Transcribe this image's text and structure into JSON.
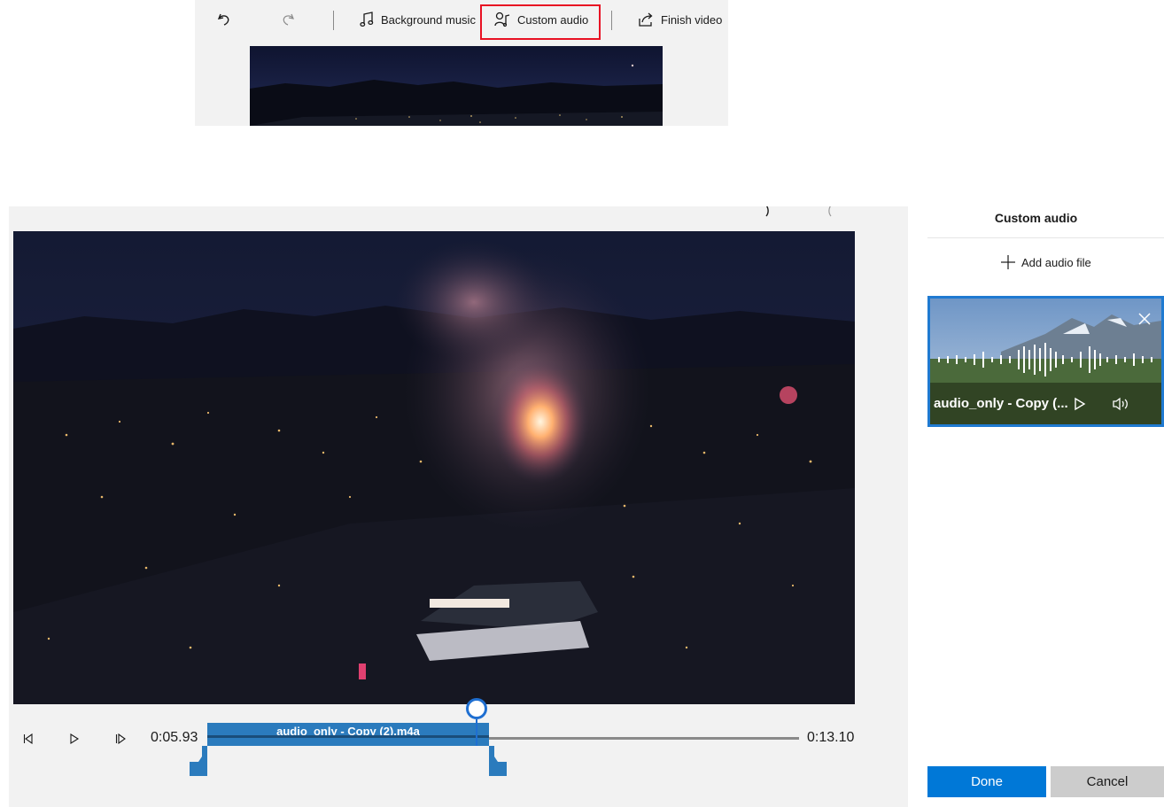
{
  "toolbar": {
    "undo_icon": "undo-icon",
    "redo_icon": "redo-icon",
    "background_music_label": "Background music",
    "custom_audio_label": "Custom audio",
    "finish_video_label": "Finish video",
    "highlight_color": "#e81123"
  },
  "playback": {
    "current_time": "0:05.93",
    "end_time": "0:13.10",
    "progress": 0.45
  },
  "timeline": {
    "clip_label": "audio_only - Copy (2).m4a",
    "clip_color": "#2b7bbd"
  },
  "panel": {
    "title": "Custom audio",
    "add_audio_label": "Add audio file",
    "audio_card": {
      "name": "audio_only - Copy (..."
    },
    "done_label": "Done",
    "cancel_label": "Cancel",
    "accent_color": "#0078d7"
  }
}
